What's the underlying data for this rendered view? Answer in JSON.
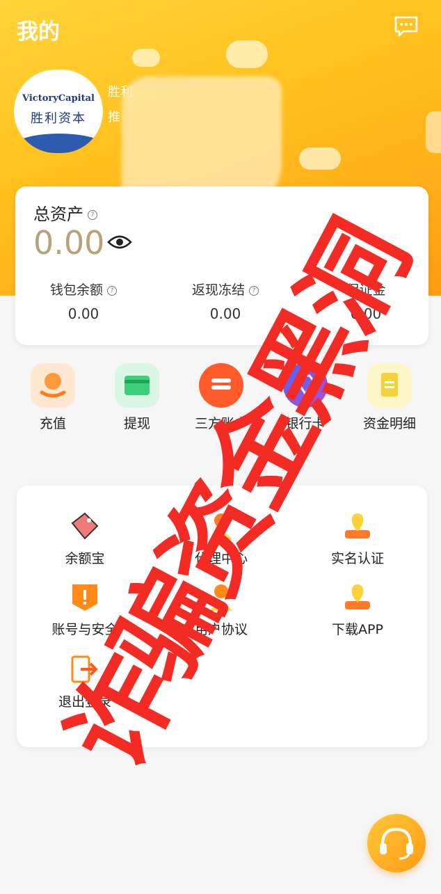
{
  "header": {
    "title": "我的"
  },
  "profile": {
    "avatar_brand_en": "VictoryCapital",
    "avatar_brand_cn": "胜利资本",
    "username": "胜利",
    "subline": "推"
  },
  "assets": {
    "total_label": "总资产",
    "total_value": "0.00",
    "stats": [
      {
        "label": "钱包余额",
        "value": "0.00"
      },
      {
        "label": "返现冻结",
        "value": "0.00"
      },
      {
        "label": "保证金",
        "value": "0.00"
      }
    ]
  },
  "quick_actions": [
    {
      "label": "充值",
      "icon": "recharge-icon",
      "color": "#ffa142"
    },
    {
      "label": "提现",
      "icon": "withdraw-icon",
      "color": "#3fcf7a"
    },
    {
      "label": "三方账户",
      "icon": "third-party-account-icon",
      "color": "#ff5a2a"
    },
    {
      "label": "银行卡",
      "icon": "bank-card-icon",
      "color": "#5b4ce0"
    },
    {
      "label": "资金明细",
      "icon": "fund-detail-icon",
      "color": "#f5d23c"
    }
  ],
  "menu": [
    {
      "label": "余额宝",
      "icon": "tag-icon"
    },
    {
      "label": "代理中心",
      "icon": "agent-icon"
    },
    {
      "label": "实名认证",
      "icon": "location-pin-icon"
    },
    {
      "label": "账号与安全",
      "icon": "shield-alert-icon"
    },
    {
      "label": "用户协议",
      "icon": "user-icon"
    },
    {
      "label": "下载APP",
      "icon": "download-pin-icon"
    },
    {
      "label": "退出登录",
      "icon": "logout-icon"
    }
  ],
  "overlay_text": "诈骗资金黑洞",
  "support": {
    "icon": "headset-icon"
  }
}
